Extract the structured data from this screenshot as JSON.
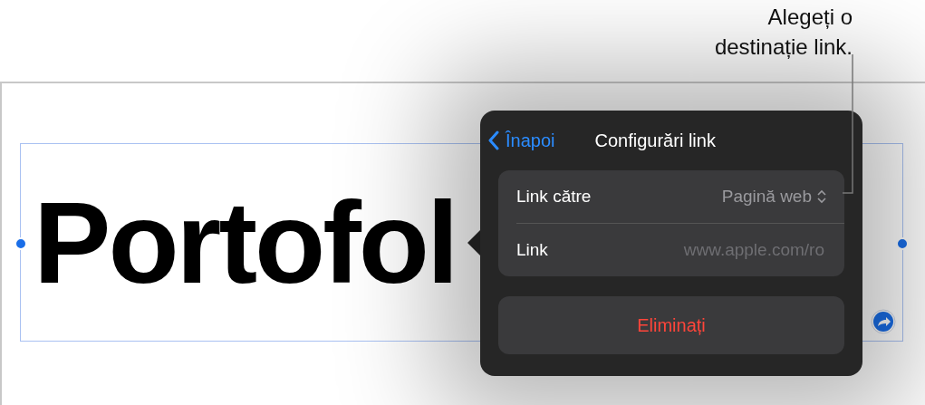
{
  "callout": {
    "text": "Alegeți o destinație link."
  },
  "canvas": {
    "title": "Portofol"
  },
  "popover": {
    "back": "Înapoi",
    "title": "Configurări link",
    "rows": [
      {
        "kind": "picker",
        "label": "Link către",
        "value": "Pagină web"
      },
      {
        "kind": "field",
        "label": "Link",
        "placeholder": "www.apple.com/ro"
      }
    ],
    "delete": "Eliminați"
  }
}
